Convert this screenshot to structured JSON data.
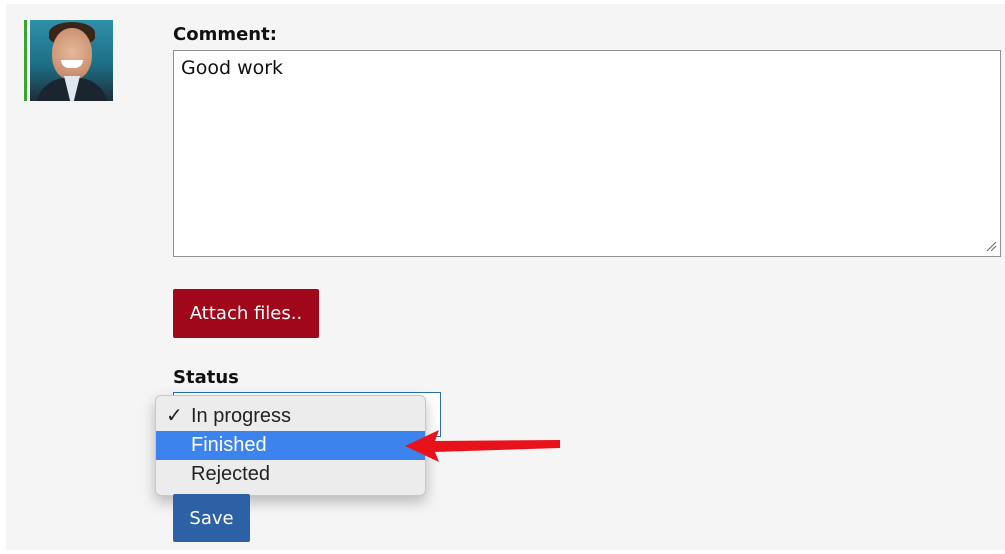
{
  "comment": {
    "label": "Comment:",
    "value": "Good work"
  },
  "attach_button": {
    "label": "Attach files.."
  },
  "status": {
    "label": "Status",
    "options": [
      {
        "label": "In progress",
        "checked": true,
        "highlighted": false
      },
      {
        "label": "Finished",
        "checked": false,
        "highlighted": true
      },
      {
        "label": "Rejected",
        "checked": false,
        "highlighted": false
      }
    ],
    "check_glyph": "✓"
  },
  "save_button": {
    "label": "Save"
  },
  "colors": {
    "accent_green": "#3aa52e",
    "attach_red": "#a0071b",
    "save_blue": "#2c61a5",
    "highlight_blue": "#3d83ee",
    "annotation_arrow": "#e8121b"
  },
  "icons": {
    "avatar": "user-avatar-photo",
    "resize": "resize-grip-icon",
    "annotation": "red-arrow-icon"
  }
}
